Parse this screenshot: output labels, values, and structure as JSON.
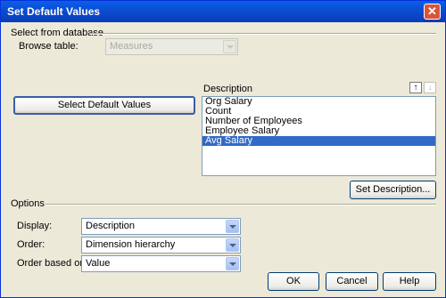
{
  "window": {
    "title": "Set Default Values",
    "close_glyph": "✕"
  },
  "select_from_database": {
    "section_label": "Select from database",
    "browse_label": "Browse table:",
    "browse_value": "Measures"
  },
  "select_button": "Select Default Values",
  "description": {
    "label": "Description",
    "up_glyph": "↑",
    "down_glyph": "↓",
    "items": [
      "Org Salary",
      "Count",
      "Number of Employees",
      "Employee Salary",
      "Avg Salary"
    ],
    "selected_index": 4
  },
  "set_description_button": "Set Description...",
  "options": {
    "section_label": "Options",
    "display_label": "Display:",
    "display_value": "Description",
    "order_label": "Order:",
    "order_value": "Dimension hierarchy",
    "order_based_label": "Order based on:",
    "order_based_value": "Value"
  },
  "buttons": {
    "ok": "OK",
    "cancel": "Cancel",
    "help": "Help"
  },
  "colors": {
    "title_bar": "#0b47c9",
    "selection": "#316ac5",
    "dialog_bg": "#ece9d8"
  }
}
